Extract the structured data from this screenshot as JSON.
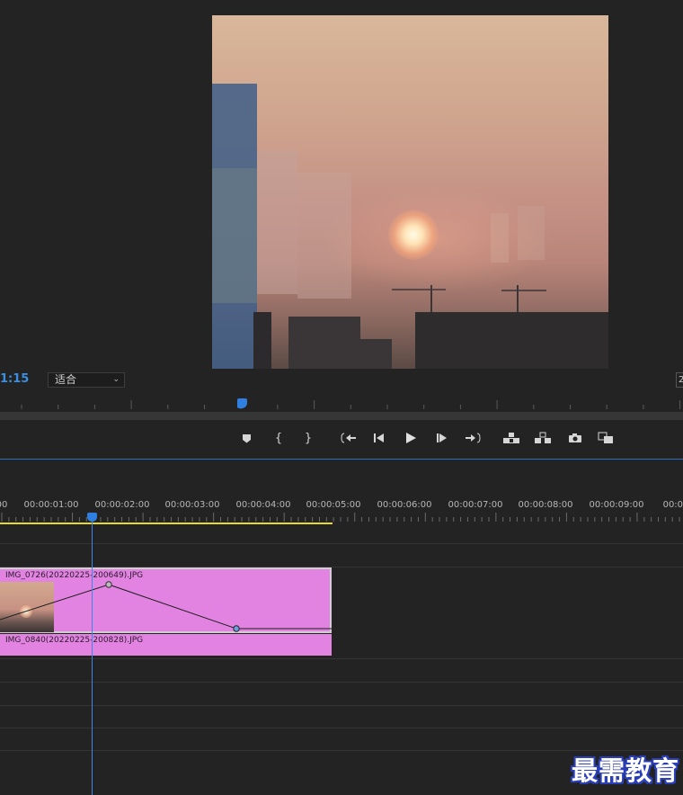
{
  "monitor": {
    "timecode": "1:15",
    "fit": "适合",
    "right_button": "2"
  },
  "transport": {
    "buttons": [
      {
        "name": "add-marker-button",
        "glyph": "⬟"
      },
      {
        "name": "mark-in-button",
        "glyph": "{"
      },
      {
        "name": "mark-out-button",
        "glyph": "}"
      },
      {
        "name": "go-to-in-button",
        "glyph": "{⇤"
      },
      {
        "name": "step-back-button",
        "glyph": "◀|"
      },
      {
        "name": "play-button",
        "glyph": "▶"
      },
      {
        "name": "step-forward-button",
        "glyph": "|▶"
      },
      {
        "name": "go-to-out-button",
        "glyph": "⇥}"
      },
      {
        "name": "lift-button",
        "glyph": "⏏"
      },
      {
        "name": "extract-button",
        "glyph": "⏏"
      },
      {
        "name": "export-frame-button",
        "glyph": "📷"
      },
      {
        "name": "comparison-view-button",
        "glyph": "⧉"
      }
    ]
  },
  "timeline": {
    "ruler_labels": [
      "00",
      "00:00:01:00",
      "00:00:02:00",
      "00:00:03:00",
      "00:00:04:00",
      "00:00:05:00",
      "00:00:06:00",
      "00:00:07:00",
      "00:00:08:00",
      "00:00:09:00",
      "00:00"
    ],
    "clips": {
      "v2_name": "IMG_0726(20220225-200649).JPG",
      "v1_name": "IMG_0840(20220225-200828).JPG",
      "color": "#e283e2"
    }
  },
  "colors": {
    "accent": "#2f7fe0",
    "work_area": "#e8d82c"
  },
  "watermark": "最需教育"
}
